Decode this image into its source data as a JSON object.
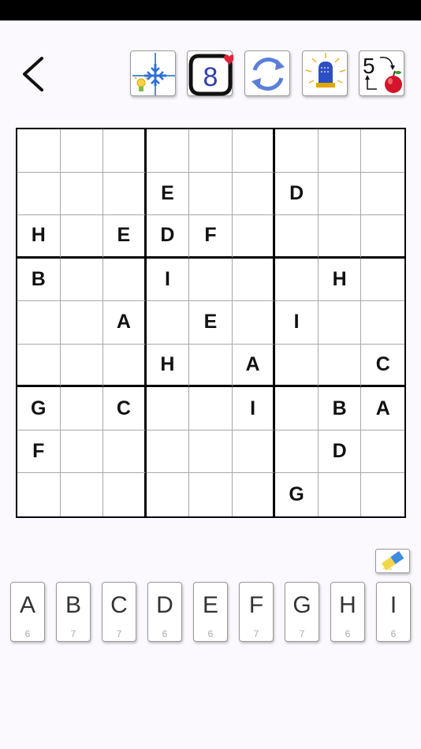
{
  "toolbar": {
    "back_icon": "chevron-left-icon",
    "tools": [
      {
        "name": "hint",
        "icon": "lightbulb-crosshair-icon"
      },
      {
        "name": "favorite-number",
        "icon": "number-8-heart-icon",
        "label": "8"
      },
      {
        "name": "restart",
        "icon": "refresh-arrows-icon"
      },
      {
        "name": "alarm",
        "icon": "siren-icon"
      },
      {
        "name": "symbol-mode",
        "icon": "number-to-apple-icon",
        "label": "5"
      }
    ]
  },
  "board": {
    "rows": [
      [
        "",
        "",
        "",
        "",
        "",
        "",
        "",
        "",
        ""
      ],
      [
        "",
        "",
        "",
        "E",
        "",
        "",
        "D",
        "",
        ""
      ],
      [
        "H",
        "",
        "E",
        "D",
        "F",
        "",
        "",
        "",
        ""
      ],
      [
        "B",
        "",
        "",
        "I",
        "",
        "",
        "",
        "H",
        ""
      ],
      [
        "",
        "",
        "A",
        "",
        "E",
        "",
        "I",
        "",
        ""
      ],
      [
        "",
        "",
        "",
        "H",
        "",
        "A",
        "",
        "",
        "C"
      ],
      [
        "G",
        "",
        "C",
        "",
        "",
        "I",
        "",
        "B",
        "A"
      ],
      [
        "F",
        "",
        "",
        "",
        "",
        "",
        "",
        "D",
        ""
      ],
      [
        "",
        "",
        "",
        "",
        "",
        "",
        "G",
        "",
        ""
      ]
    ]
  },
  "eraser": {
    "icon": "eraser-icon"
  },
  "keypad": {
    "keys": [
      {
        "letter": "A",
        "count": "6"
      },
      {
        "letter": "B",
        "count": "7"
      },
      {
        "letter": "C",
        "count": "7"
      },
      {
        "letter": "D",
        "count": "6"
      },
      {
        "letter": "E",
        "count": "6"
      },
      {
        "letter": "F",
        "count": "7"
      },
      {
        "letter": "G",
        "count": "7"
      },
      {
        "letter": "H",
        "count": "6"
      },
      {
        "letter": "I",
        "count": "6"
      }
    ]
  },
  "colors": {
    "background": "#fbf9fd",
    "grid_thick": "#000000",
    "grid_thin": "#a8a8a8",
    "accent_blue": "#2f6fd6",
    "accent_red": "#e0243a"
  }
}
